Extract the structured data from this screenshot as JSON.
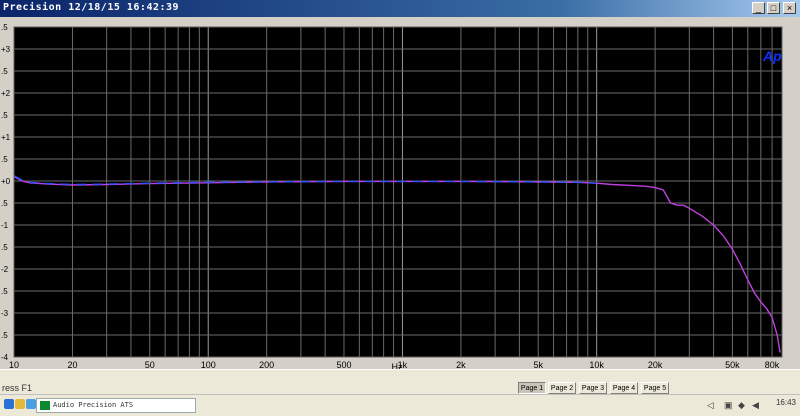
{
  "window": {
    "title": "Precision   12/18/15 16:42:39"
  },
  "logo": "Ap",
  "chart_data": {
    "type": "line",
    "xlabel": "Hz",
    "xscale": "log",
    "xlim": [
      10,
      90000
    ],
    "ylim": [
      -4,
      3.5
    ],
    "x_ticks": [
      {
        "v": 10,
        "label": "10"
      },
      {
        "v": 20,
        "label": "20"
      },
      {
        "v": 50,
        "label": "50"
      },
      {
        "v": 100,
        "label": "100"
      },
      {
        "v": 200,
        "label": "200"
      },
      {
        "v": 500,
        "label": "500"
      },
      {
        "v": 1000,
        "label": "1k"
      },
      {
        "v": 2000,
        "label": "2k"
      },
      {
        "v": 5000,
        "label": "5k"
      },
      {
        "v": 10000,
        "label": "10k"
      },
      {
        "v": 20000,
        "label": "20k"
      },
      {
        "v": 50000,
        "label": "50k"
      },
      {
        "v": 80000,
        "label": "80k"
      }
    ],
    "y_ticks": [
      {
        "v": 3.5,
        "label": ".5"
      },
      {
        "v": 3,
        "label": "+3"
      },
      {
        "v": 2.5,
        "label": ".5"
      },
      {
        "v": 2,
        "label": "+2"
      },
      {
        "v": 1.5,
        "label": ".5"
      },
      {
        "v": 1,
        "label": "+1"
      },
      {
        "v": 0.5,
        "label": ".5"
      },
      {
        "v": 0,
        "label": "+0"
      },
      {
        "v": -0.5,
        "label": ".5"
      },
      {
        "v": -1,
        "label": "-1"
      },
      {
        "v": -1.5,
        "label": ".5"
      },
      {
        "v": -2,
        "label": "-2"
      },
      {
        "v": -2.5,
        "label": ".5"
      },
      {
        "v": -3,
        "label": "-3"
      },
      {
        "v": -3.5,
        "label": ".5"
      },
      {
        "v": -4,
        "label": "-4"
      }
    ],
    "grid": true,
    "series": [
      {
        "color": "#c040e0",
        "x": [
          10,
          11,
          12,
          15,
          20,
          30,
          50,
          100,
          200,
          500,
          1000,
          2000,
          5000,
          8000,
          10000,
          12000,
          15000,
          18000,
          20000,
          22000,
          23000,
          24000,
          26000,
          28000,
          30000,
          35000,
          40000,
          45000,
          50000,
          55000,
          60000,
          65000,
          70000,
          75000,
          80000,
          85000,
          88000
        ],
        "y": [
          0.1,
          0.0,
          -0.04,
          -0.07,
          -0.09,
          -0.08,
          -0.06,
          -0.04,
          -0.02,
          -0.01,
          -0.01,
          -0.01,
          -0.02,
          -0.03,
          -0.05,
          -0.08,
          -0.1,
          -0.12,
          -0.15,
          -0.2,
          -0.35,
          -0.5,
          -0.55,
          -0.55,
          -0.62,
          -0.8,
          -1.0,
          -1.25,
          -1.55,
          -1.9,
          -2.25,
          -2.55,
          -2.75,
          -2.9,
          -3.1,
          -3.5,
          -3.9
        ]
      },
      {
        "color": "#3050ff",
        "dashed": true,
        "x": [
          10,
          11,
          12,
          15,
          20,
          30,
          50,
          100,
          200,
          500,
          1000,
          2000,
          5000,
          8000,
          10000
        ],
        "y": [
          0.12,
          0.02,
          -0.03,
          -0.06,
          -0.08,
          -0.07,
          -0.05,
          -0.03,
          -0.02,
          -0.01,
          -0.01,
          -0.01,
          -0.02,
          -0.03,
          -0.05
        ]
      }
    ]
  },
  "status": {
    "hint": "ress F1"
  },
  "pages": [
    "Page 1",
    "Page 2",
    "Page 3",
    "Page 4",
    "Page 5"
  ],
  "taskbar": {
    "task": "Audio Precision ATS",
    "clock": "16:43"
  }
}
